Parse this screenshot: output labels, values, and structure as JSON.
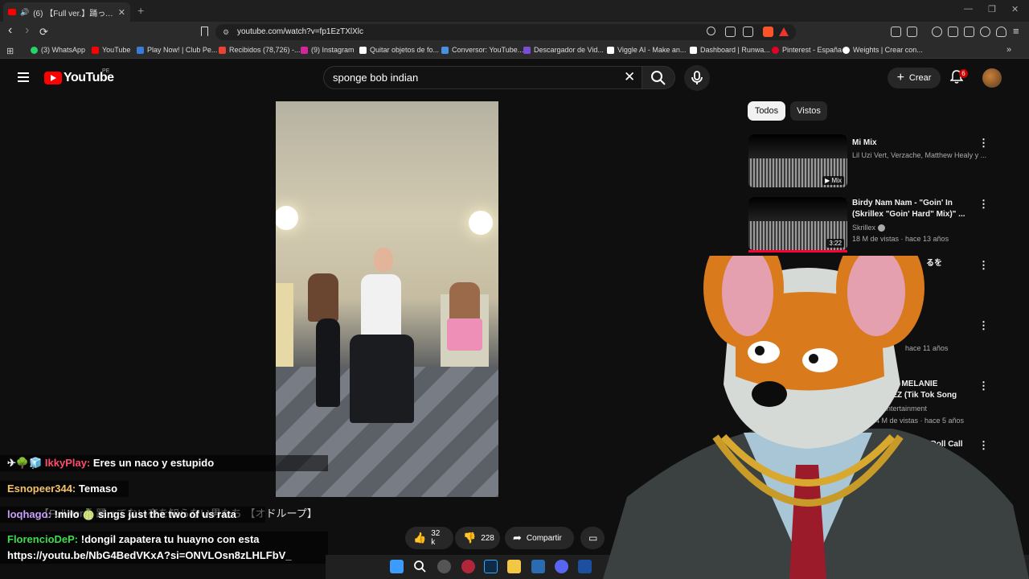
{
  "browser": {
    "tab_title": "(6) 【Full ver.】踊ってない夜を知らない",
    "tab_close": "✕",
    "new_tab": "+",
    "url": "youtube.com/watch?v=fp1EzTXlXlc",
    "window_controls": {
      "minimize": "—",
      "maximize": "❐",
      "close": "✕"
    },
    "nav": {
      "back": "‹",
      "forward": "›",
      "reload": "⟳"
    }
  },
  "bookmarks": [
    {
      "label": "(3) WhatsApp",
      "color": "#25d366"
    },
    {
      "label": "YouTube",
      "color": "#ff0000"
    },
    {
      "label": "Play Now! | Club Pe...",
      "color": "#3a7bd5"
    },
    {
      "label": "Recibidos (78,726) -...",
      "color": "#ea4335"
    },
    {
      "label": "(9) Instagram",
      "color": "#d6249f"
    },
    {
      "label": "Quitar objetos de fo...",
      "color": "#ffffff"
    },
    {
      "label": "Conversor: YouTube...",
      "color": "#4a90e2"
    },
    {
      "label": "Descargador de Vid...",
      "color": "#7b4dd6"
    },
    {
      "label": "Viggle AI - Make an...",
      "color": "#ffffff"
    },
    {
      "label": "Dashboard | Runwa...",
      "color": "#ffffff"
    },
    {
      "label": "Pinterest - España",
      "color": "#e60023"
    },
    {
      "label": "Weights | Crear con...",
      "color": "#ffffff"
    }
  ],
  "youtube": {
    "logo_text": "YouTube",
    "country": "PE",
    "search_query": "sponge bob indian",
    "create_label": "Crear",
    "notifications_count": "6"
  },
  "chips": [
    "Todos",
    "Vistos"
  ],
  "sidebar_videos": [
    {
      "title": "Mi Mix",
      "meta": "Lil Uzi Vert, Verzache, Matthew Healy y ...",
      "badge": "Mix",
      "stats": ""
    },
    {
      "title": "Birdy Nam Nam - \"Goin' In (Skrillex \"Goin' Hard\" Mix)\" ...",
      "meta": "Skrillex",
      "badge": "3:22",
      "stats": "18 M de vistas · hace 13 años"
    },
    {
      "title": "るを",
      "meta": "",
      "badge": "",
      "stats": ""
    },
    {
      "title": "",
      "meta": "",
      "badge": "",
      "stats": "hace 11 años"
    },
    {
      "title": "DATE - MELANIE RTINEZ (Tik Tok Song ...",
      "meta": "x Entertainment",
      "badge": "",
      "stats": "24 M de vistas · hace 5 años"
    },
    {
      "title": "hourhood - Roll Call",
      "meta": "",
      "badge": "",
      "stats": ""
    }
  ],
  "video_title": "【Full ver.】踊ってない夜を知らない男たち 【オドループ】",
  "actions": {
    "likes": "32 k",
    "dislikes": "228",
    "share": "Compartir"
  },
  "chat": [
    {
      "user": "IkkyPlay:",
      "user_color": "#ff4d6d",
      "prefix": "✈🌳🧊",
      "msg": "Eres un naco y estupido"
    },
    {
      "user": "Esnopeer344:",
      "user_color": "#f5c26b",
      "prefix": "",
      "msg": "Temaso"
    },
    {
      "user": "loqhago:",
      "user_color": "#c9a0ff",
      "prefix": "",
      "msg": "!milo 🍈 sings just the two of us rata"
    },
    {
      "user": "FlorencioDeP:",
      "user_color": "#3ddc4f",
      "prefix": "",
      "msg": "!dongil zapatera tu huayno con esta"
    },
    {
      "user": "",
      "user_color": "#ffffff",
      "prefix": "",
      "msg": "https://youtu.be/NbG4BedVKxA?si=ONVLOsn8zLHLFbV_"
    }
  ],
  "colors": {
    "accent": "#ff0000",
    "background": "#0f0f0f"
  }
}
